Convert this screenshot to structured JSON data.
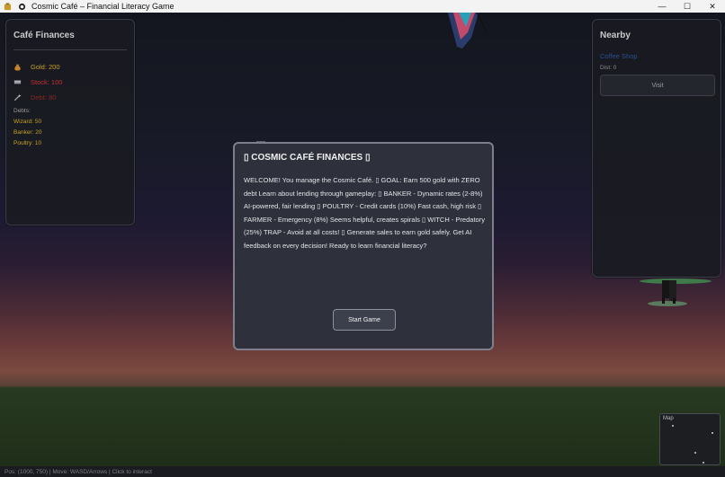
{
  "window": {
    "title": "Cosmic Café – Financial Literacy Game",
    "minimize": "—",
    "maximize": "☐",
    "close": "✕"
  },
  "finances": {
    "title": "Café Finances",
    "gold": "Gold: 200",
    "stock": "Stock: 100",
    "debt": "Debt: 80",
    "debts_label": "Debts:",
    "debts": [
      "Wizard: 50",
      "Banker: 20",
      "Poultry: 10"
    ],
    "colors": {
      "gold": "#c8a020",
      "stock": "#c23030",
      "debt": "#8a2525"
    }
  },
  "nearby": {
    "title": "Nearby",
    "place": "Coffee Shop",
    "distance": "Dist: 0",
    "visit_label": "Visit"
  },
  "modal": {
    "title": "▯ COSMIC CAFÉ FINANCES ▯",
    "body": "WELCOME! You manage the Cosmic Café. ▯ GOAL: Earn 500 gold with ZERO debt Learn about lending through gameplay: ▯ BANKER - Dynamic rates (2-8%) AI-powered, fair lending ▯ POULTRY - Credit cards (10%) Fast cash, high risk ▯ FARMER - Emergency (8%) Seems helpful, creates spirals ▯ WITCH - Predatory (25%) TRAP - Avoid at all costs! ▯ Generate sales to earn gold safely. Get AI feedback on every decision! Ready to learn financial literacy?",
    "start_label": "Start Game"
  },
  "minimap": {
    "label": "Map"
  },
  "status": {
    "text": "Pos: (1000, 750) | Move: WASD/Arrows | Click to interact"
  },
  "icons": {
    "gold": "money-bag-icon",
    "stock": "box-icon",
    "debt": "wand-icon"
  }
}
